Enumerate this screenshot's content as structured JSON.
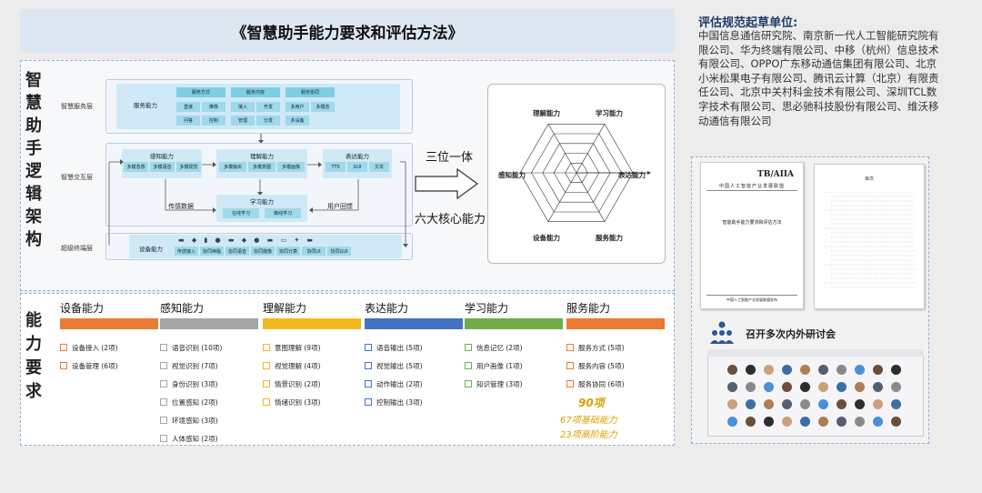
{
  "title": "《智慧助手能力要求和评估方法》",
  "left_vertical_title": [
    "智",
    "慧",
    "助",
    "手",
    "逻",
    "辑",
    "架",
    "构"
  ],
  "bottom_vertical_title": [
    "能",
    "力",
    "要",
    "求"
  ],
  "architecture": {
    "service_layer": {
      "label": "智慧服务层",
      "group_title": "服务能力",
      "subgroups": [
        {
          "title": "服务方式",
          "items": [
            "直接",
            "推荐",
            "问答",
            "控制"
          ]
        },
        {
          "title": "服务内容",
          "items": [
            "接入",
            "开发",
            "管理",
            "分发"
          ]
        },
        {
          "title": "服务协同",
          "items": [
            "多用户",
            "多模态",
            "多设备"
          ]
        }
      ]
    },
    "interaction_layer": {
      "label": "智慧交互层",
      "perception": {
        "title": "感知能力",
        "items": [
          "多模态感",
          "多模语音",
          "多模视觉"
        ]
      },
      "understanding": {
        "title": "理解能力",
        "items": [
          "多模输出",
          "多模意图",
          "多模画像"
        ]
      },
      "expression": {
        "title": "表达能力",
        "items": [
          "TTS",
          "GUI",
          "文本"
        ]
      },
      "learning": {
        "title": "学习能力",
        "items": [
          "在线学习",
          "离线学习"
        ]
      },
      "data_label": "传感数据",
      "feedback_label": "用户回馈"
    },
    "terminal_layer": {
      "label": "超级终端层",
      "group_title": "设备能力",
      "items": [
        "传感接入",
        "协同唤醒",
        "协同语音",
        "协同摄像",
        "协同计算",
        "协同UI",
        "协同GUI"
      ]
    }
  },
  "arrow": {
    "top": "三位一体",
    "bottom": "六大核心能力"
  },
  "radar": {
    "labels": [
      "理解能力",
      "学习能力",
      "表达能力",
      "服务能力",
      "设备能力",
      "感知能力"
    ]
  },
  "capabilities": [
    {
      "title": "设备能力",
      "color": "#ec7a34",
      "items": [
        "设备接入 (2项)",
        "设备管理 (6项)"
      ]
    },
    {
      "title": "感知能力",
      "color": "#a5a5a5",
      "items": [
        "语音识别 (10项)",
        "视觉识别 (7项)",
        "身份识别 (3项)",
        "位置感知 (2项)",
        "环境感知 (3项)",
        "人体感知 (2项)"
      ]
    },
    {
      "title": "理解能力",
      "color": "#f4b81e",
      "items": [
        "意图理解 (9项)",
        "视觉理解 (4项)",
        "情景识别 (2项)",
        "情绪识别 (3项)"
      ]
    },
    {
      "title": "表达能力",
      "color": "#4472c4",
      "items": [
        "语音输出 (5项)",
        "视觉输出 (5项)",
        "动作输出 (2项)",
        "控制输出 (3项)"
      ]
    },
    {
      "title": "学习能力",
      "color": "#70ad47",
      "items": [
        "信息记忆 (2项)",
        "用户画像 (1项)",
        "知识管理 (3项)"
      ]
    },
    {
      "title": "服务能力",
      "color": "#ec7a34",
      "items": [
        "服务方式 (5项)",
        "服务内容 (5项)",
        "服务协同 (6项)"
      ]
    }
  ],
  "totals": {
    "total": "90项",
    "basic": "67项基础能力",
    "advanced": "23项高阶能力"
  },
  "drafters": {
    "title": "评估规范起草单位:",
    "text": "中国信息通信研究院、南京新一代人工智能研究院有限公司、华为终端有限公司、中移（杭州）信息技术有限公司、OPPO广东移动通信集团有限公司、北京小米松果电子有限公司、腾讯云计算（北京）有限责任公司、北京中关村科金技术有限公司、深圳TCL数字技术有限公司、思必驰科技股份有限公司、维沃移动通信有限公司"
  },
  "doc_cover": {
    "code": "TB/AIIA",
    "org": "中国人工智能产业发展联盟",
    "doc_title": "智能助手能力要求和评估方法",
    "footer": "中国人工智能产业发展联盟发布"
  },
  "toc_title": "目次",
  "seminar_label": "召开多次内外研讨会"
}
